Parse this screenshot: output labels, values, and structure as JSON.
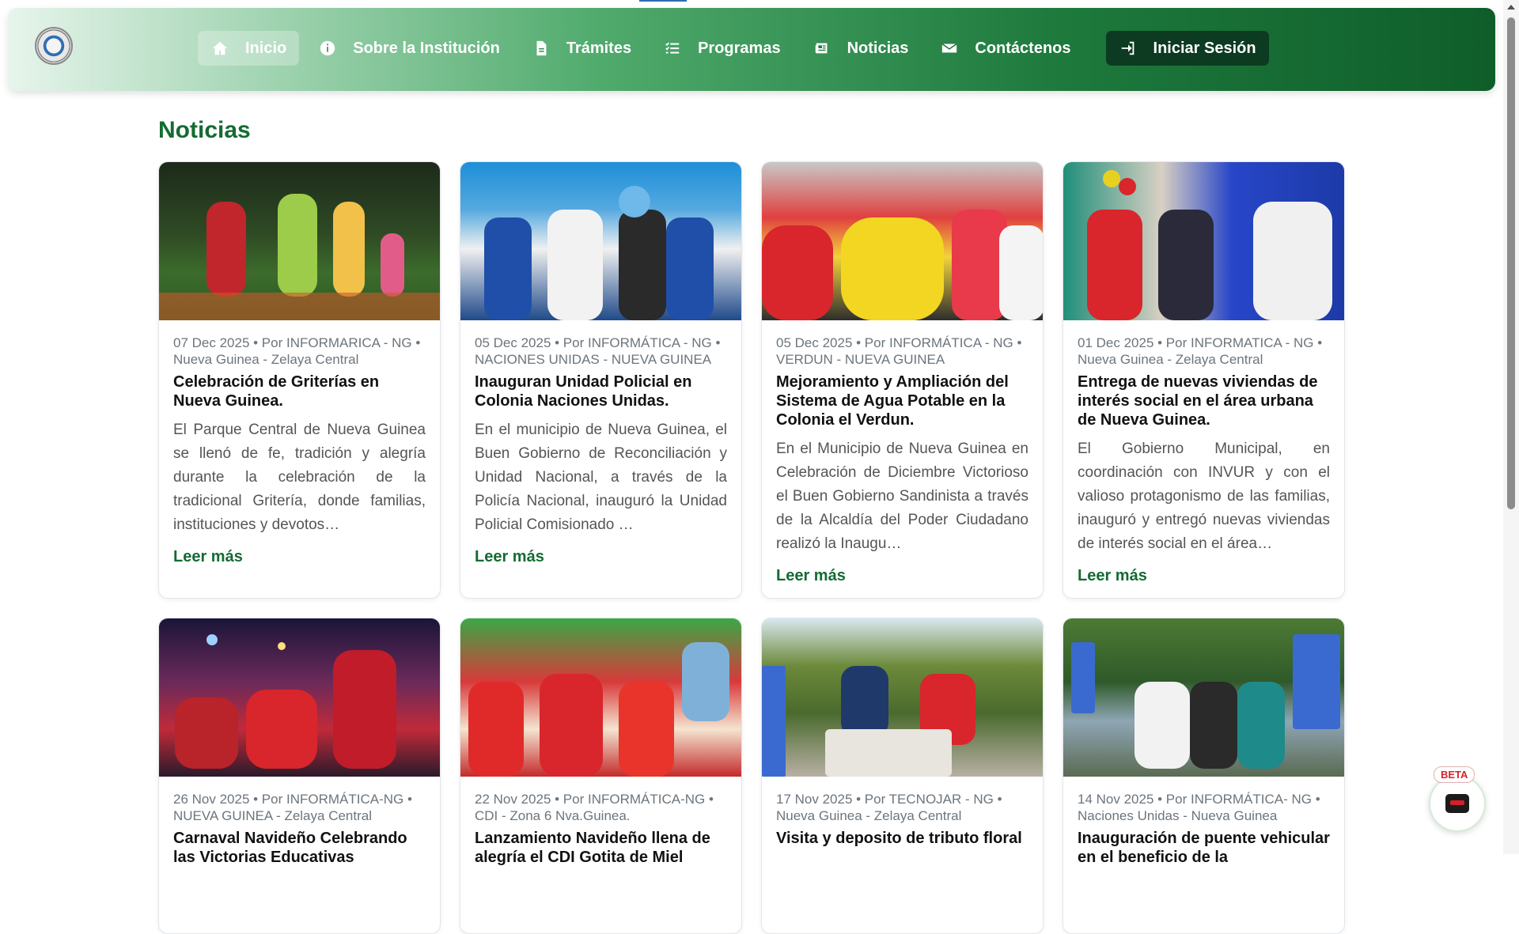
{
  "header": {
    "nav": [
      {
        "label": "Inicio",
        "icon": "home-icon"
      },
      {
        "label": "Sobre la Institución",
        "icon": "info-icon"
      },
      {
        "label": "Trámites",
        "icon": "document-icon"
      },
      {
        "label": "Programas",
        "icon": "list-icon"
      },
      {
        "label": "Noticias",
        "icon": "newspaper-icon"
      },
      {
        "label": "Contáctenos",
        "icon": "envelope-icon"
      },
      {
        "label": "Iniciar Sesión",
        "icon": "sign-in-icon"
      }
    ]
  },
  "main": {
    "title": "Noticias",
    "cards": [
      {
        "meta": "07 Dec 2025 • Por INFORMARICA - NG • Nueva Guinea - Zelaya Central",
        "title": "Celebración de Griterías en Nueva Guinea.",
        "excerpt": "El Parque Central de Nueva Guinea se llenó de fe, tradición y alegría durante la celebración de la tradicional Gritería, donde familias, instituciones y devotos…",
        "link": "Leer más"
      },
      {
        "meta": "05 Dec 2025 • Por INFORMÁTICA - NG • NACIONES UNIDAS - NUEVA GUINEA",
        "title": "Inauguran Unidad Policial en Colonia Naciones Unidas.",
        "excerpt": "En el municipio de Nueva Guinea, el Buen Gobierno de Reconciliación y Unidad Nacional, a través de la Policía Nacional, inauguró la Unidad Policial Comisionado …",
        "link": "Leer más"
      },
      {
        "meta": "05 Dec 2025 • Por INFORMÁTICA - NG • VERDUN - NUEVA GUINEA",
        "title": "Mejoramiento y Ampliación del Sistema de Agua Potable en la Colonia el Verdun.",
        "excerpt": "En el Municipio de Nueva Guinea en Celebración de Diciembre Victorioso el Buen Gobierno Sandinista a través de la Alcaldía del Poder Ciudadano realizó la Inaugu…",
        "link": "Leer más"
      },
      {
        "meta": "01 Dec 2025 • Por INFORMATICA - NG • Nueva Guinea - Zelaya Central",
        "title": "Entrega de nuevas viviendas de interés social en el área urbana de Nueva Guinea.",
        "excerpt": "El Gobierno Municipal, en coordinación con INVUR y con el valioso protagonismo de las familias, inauguró y entregó nuevas viviendas de interés social en el área…",
        "link": "Leer más"
      },
      {
        "meta": "26 Nov 2025 • Por INFORMÁTICA-NG • NUEVA GUINEA - Zelaya Central",
        "title": "Carnaval Navideño Celebrando las Victorias Educativas",
        "excerpt": "",
        "link": ""
      },
      {
        "meta": "22 Nov 2025 • Por INFORMÁTICA-NG • CDI - Zona 6 Nva.Guinea.",
        "title": "Lanzamiento Navideño llena de alegría el CDI Gotita de Miel",
        "excerpt": "",
        "link": ""
      },
      {
        "meta": "17 Nov 2025 • Por TECNOJAR - NG • Nueva Guinea - Zelaya Central",
        "title": "Visita y deposito de tributo floral",
        "excerpt": "",
        "link": ""
      },
      {
        "meta": "14 Nov 2025 • Por INFORMÁTICA- NG • Naciones Unidas - Nueva Guinea",
        "title": "Inauguración de puente vehicular en el beneficio de la",
        "excerpt": "",
        "link": ""
      }
    ]
  },
  "widget": {
    "badge": "BETA",
    "icon": "chat-bot-icon"
  },
  "colors": {
    "accent": "#146b33",
    "login_bg": "#0c3b22",
    "badge": "#d61f2a"
  }
}
